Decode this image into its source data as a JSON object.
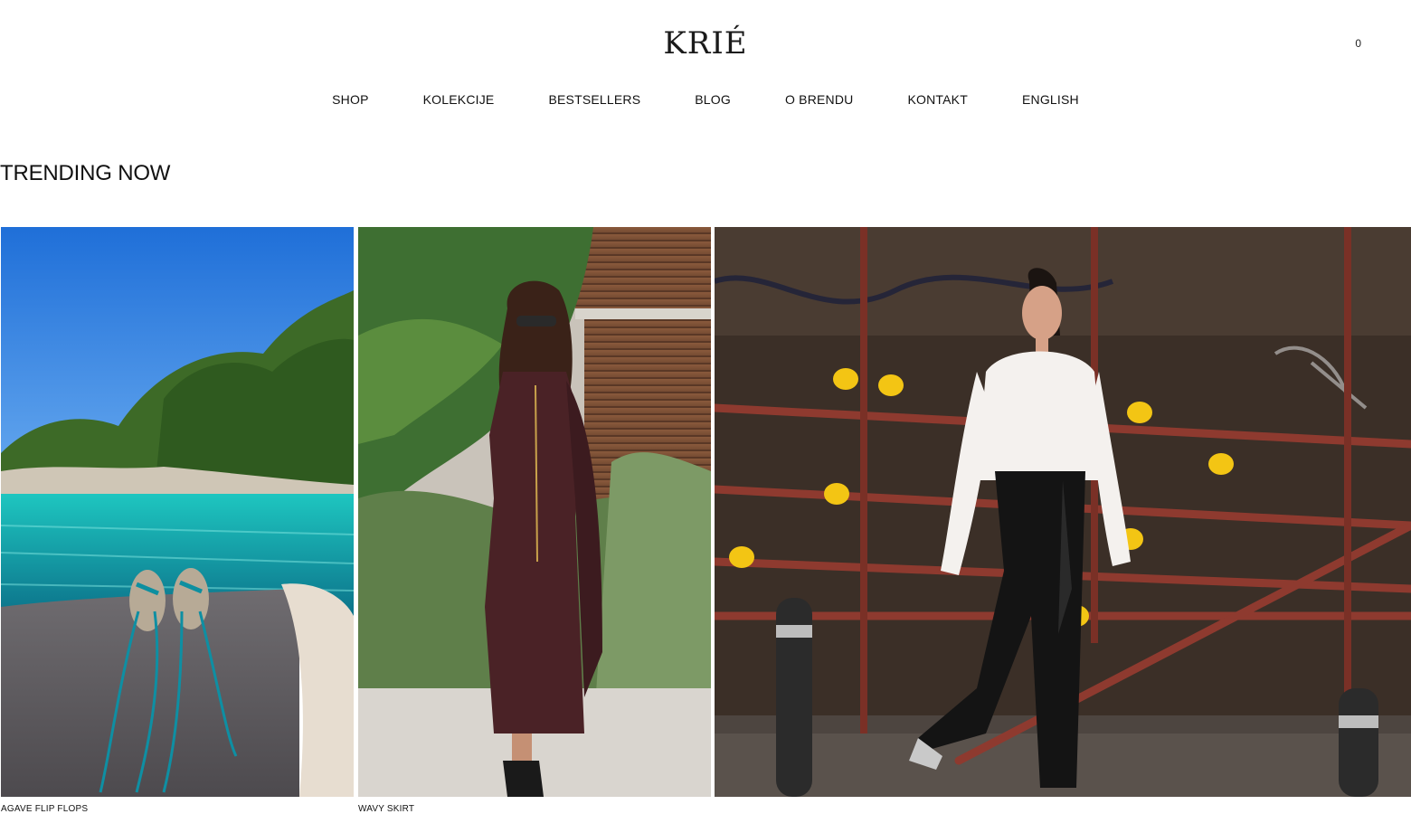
{
  "brand": {
    "logo_text": "KRIÉ"
  },
  "header": {
    "cart_count": "0"
  },
  "nav": {
    "items": [
      {
        "label": "SHOP"
      },
      {
        "label": "KOLEKCIJE"
      },
      {
        "label": "BESTSELLERS"
      },
      {
        "label": "BLOG"
      },
      {
        "label": "O BRENDU"
      },
      {
        "label": "KONTAKT"
      },
      {
        "label": "ENGLISH"
      }
    ]
  },
  "trending": {
    "title": "TRENDING NOW",
    "products": [
      {
        "name": "AGAVE FLIP FLOPS",
        "image": "turquoise-sea-flip-flops-photo"
      },
      {
        "name": "WAVY SKIRT",
        "image": "woman-burgundy-dress-photo"
      },
      {
        "name": "",
        "image": "woman-white-blouse-black-pants-street-photo"
      }
    ]
  },
  "colors": {
    "sky": "#2f7fe0",
    "sea": "#1fb3b6",
    "trees": "#3f6e2a",
    "dress": "#4a2226",
    "wall": "#3a2e25",
    "rail": "#8a3a2e",
    "yellow": "#f3c514"
  }
}
